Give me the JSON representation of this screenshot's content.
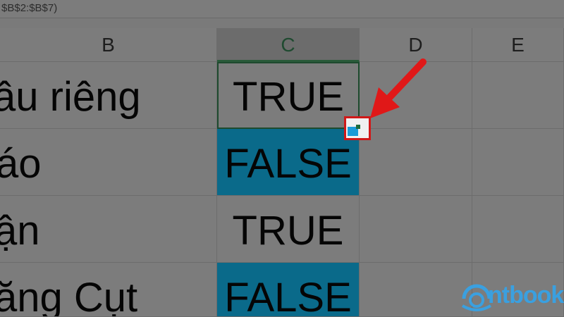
{
  "formula_bar": {
    "text": "$B$2:$B$7)"
  },
  "columns": [
    {
      "label": "B"
    },
    {
      "label": "C",
      "selected": true
    },
    {
      "label": "D"
    },
    {
      "label": "E"
    }
  ],
  "rows": [
    {
      "b": "ầu riêng",
      "c": "TRUE",
      "c_highlight": false
    },
    {
      "b": "áo",
      "c": "FALSE",
      "c_highlight": true
    },
    {
      "b": "ận",
      "c": "TRUE",
      "c_highlight": false
    },
    {
      "b": "ăng Cụt",
      "c": "FALSE",
      "c_highlight": true
    }
  ],
  "colors": {
    "highlight_fill": "#0a6a8a",
    "annotation_red": "#d01818",
    "fill_handle_blue": "#1a9bd8",
    "logo_blue": "#3aa0e0"
  },
  "icons": [
    "fill-handle-icon",
    "annotation-arrow-icon",
    "brand-logo-icon"
  ],
  "logo": {
    "text": "ntbook"
  }
}
